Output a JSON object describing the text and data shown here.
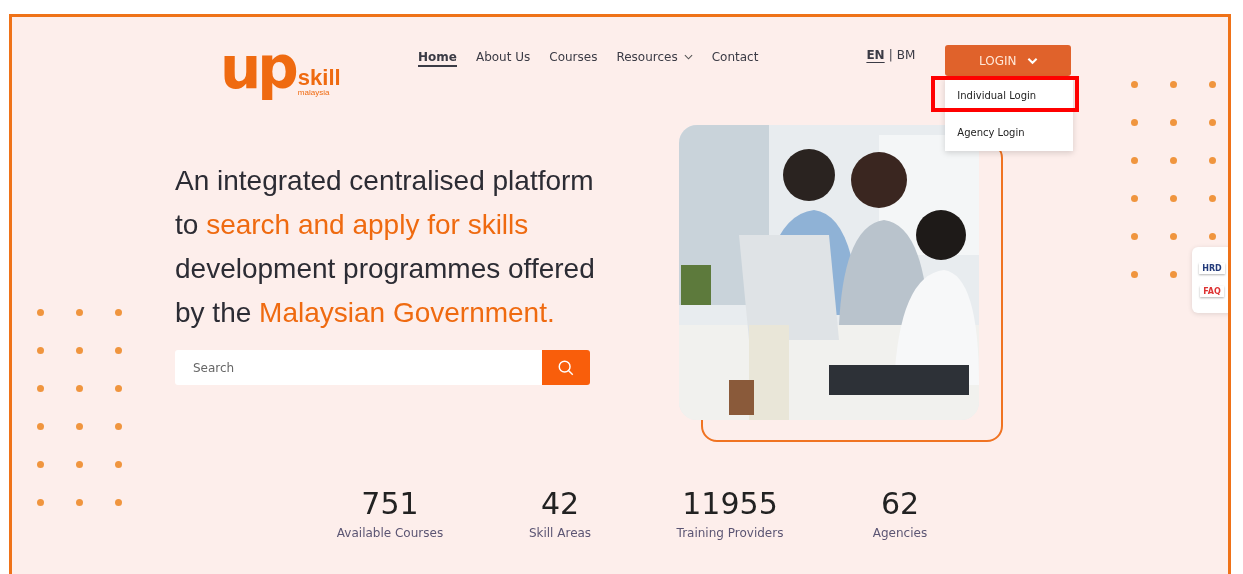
{
  "logo": {
    "mark": "up",
    "name": "skill",
    "subtitle": "malaysia"
  },
  "nav": [
    {
      "label": "Home",
      "selected": true,
      "has_menu": false
    },
    {
      "label": "About Us",
      "selected": false,
      "has_menu": false
    },
    {
      "label": "Courses",
      "selected": false,
      "has_menu": false
    },
    {
      "label": "Resources",
      "selected": false,
      "has_menu": true
    },
    {
      "label": "Contact",
      "selected": false,
      "has_menu": false
    }
  ],
  "languages": [
    {
      "label": "EN",
      "selected": true
    },
    {
      "label": "BM",
      "selected": false
    }
  ],
  "language_separator": "|",
  "login": {
    "label": "LOGIN",
    "expanded": true,
    "menu": [
      {
        "label": "Individual Login",
        "highlighted": true
      },
      {
        "label": "Agency Login",
        "highlighted": false
      }
    ]
  },
  "headline": [
    {
      "text": "An integrated centralised platform to ",
      "accent": false
    },
    {
      "text": "search and apply for skills",
      "accent": true
    },
    {
      "text": " development programmes offered by the ",
      "accent": false
    },
    {
      "text": "Malaysian Government.",
      "accent": true
    }
  ],
  "search": {
    "placeholder": "Search"
  },
  "side_widget": [
    {
      "label": "HRD"
    },
    {
      "label": "FAQ"
    }
  ],
  "stats": [
    {
      "value": "751",
      "label": "Available Courses"
    },
    {
      "value": "42",
      "label": "Skill Areas"
    },
    {
      "value": "11955",
      "label": "Training Providers"
    },
    {
      "value": "62",
      "label": "Agencies"
    }
  ]
}
